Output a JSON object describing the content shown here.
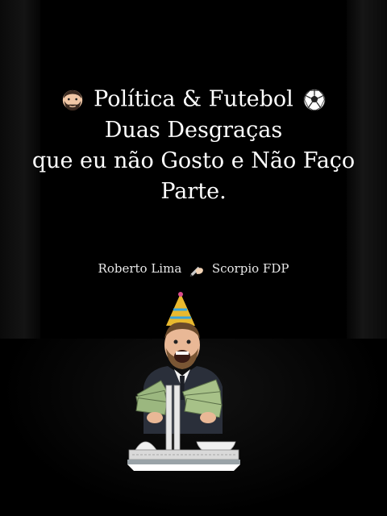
{
  "title": {
    "line1": "Política & Futebol",
    "line2": "Duas Desgraças",
    "line3": "que eu não Gosto e Não Faço",
    "line4": "Parte."
  },
  "credit": {
    "name": "Roberto Lima",
    "signature_icon": "writing-hand-icon",
    "handle": "Scorpio FDP"
  },
  "icons": {
    "person": "bearded-man-icon",
    "ball": "soccer-ball-icon"
  },
  "sticker": {
    "description_icon": "party-man-with-money-sticker"
  }
}
